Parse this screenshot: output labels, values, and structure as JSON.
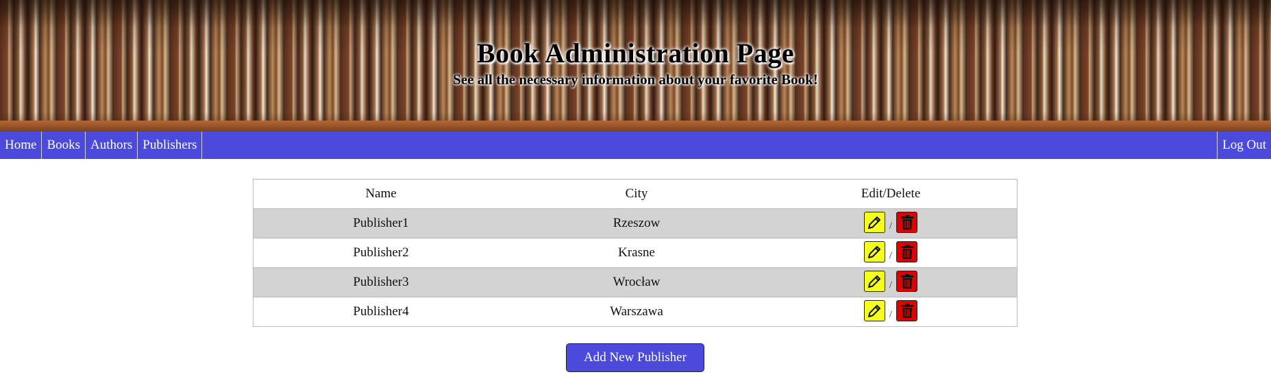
{
  "header": {
    "title": "Book Administration Page",
    "subtitle": "See all the necessary information about your favorite Book!"
  },
  "nav": {
    "items": [
      {
        "label": "Home"
      },
      {
        "label": "Books"
      },
      {
        "label": "Authors"
      },
      {
        "label": "Publishers"
      }
    ],
    "logout_label": "Log Out",
    "background_color": "#4b4adc"
  },
  "table": {
    "columns": [
      "Name",
      "City",
      "Edit/Delete"
    ],
    "separator": "/",
    "rows": [
      {
        "name": "Publisher1",
        "city": "Rzeszow"
      },
      {
        "name": "Publisher2",
        "city": "Krasne"
      },
      {
        "name": "Publisher3",
        "city": "Wrocław"
      },
      {
        "name": "Publisher4",
        "city": "Warszawa"
      }
    ],
    "icons": {
      "edit": "pencil-icon",
      "delete": "trash-icon"
    },
    "colors": {
      "edit": "#f5ff1e",
      "delete": "#e00000",
      "alt_row": "#d3d3d3"
    }
  },
  "add_button": {
    "label": "Add New Publisher"
  }
}
